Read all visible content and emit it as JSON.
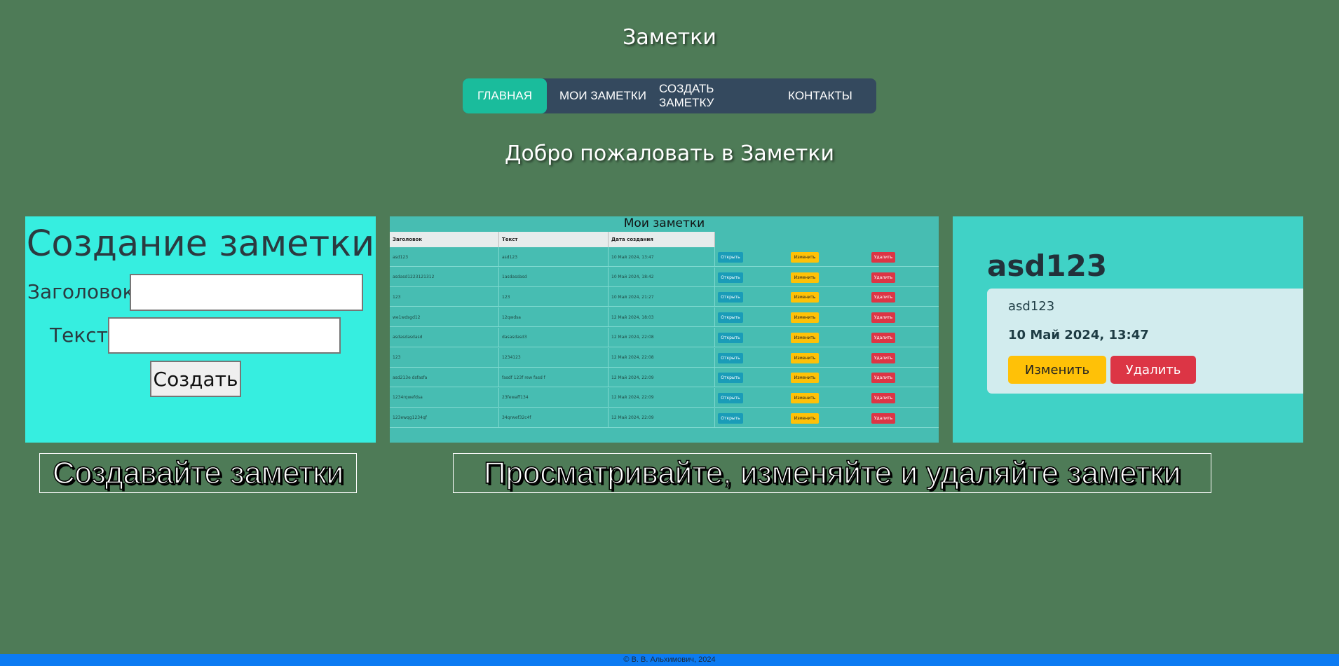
{
  "header": {
    "site_title": "Заметки"
  },
  "nav": {
    "items": [
      {
        "label": "ГЛАВНАЯ",
        "active": true
      },
      {
        "label": "МОИ ЗАМЕТКИ"
      },
      {
        "label": "СОЗДАТЬ ЗАМЕТКУ"
      },
      {
        "label": "КОНТАКТЫ"
      }
    ]
  },
  "main": {
    "welcome": "Добро пожаловать в Заметки"
  },
  "screenshots": {
    "create": {
      "title": "Создание заметки",
      "heading_label": "Заголовок:",
      "text_label": "Текст:",
      "create_button": "Создать"
    },
    "list": {
      "title": "Мои заметки",
      "columns": [
        "Заголовок",
        "Текст",
        "Дата создания"
      ],
      "open_label": "Открыть",
      "edit_label": "Изменить",
      "delete_label": "Удалить",
      "rows": [
        [
          "asd123",
          "asd123",
          "10 Май 2024, 13:47"
        ],
        [
          "asdasd1223121312",
          "1asdasdasd",
          "10 Май 2024, 18:42"
        ],
        [
          "123",
          "123",
          "10 Май 2024, 21:27"
        ],
        [
          "we1wdsgd12",
          "12qwdsa",
          "12 Май 2024, 18:03"
        ],
        [
          "asdasdasdasd",
          "dasasdasd3",
          "12 Май 2024, 22:08"
        ],
        [
          "123",
          "1234123",
          "12 Май 2024, 22:08"
        ],
        [
          "asd213e dsfasfa",
          "fasdf 123f rew fasd f",
          "12 Май 2024, 22:09"
        ],
        [
          "1234rqwefdsa",
          "23fewaff134",
          "12 Май 2024, 22:09"
        ],
        [
          "123ewqg1234qf",
          "34qrwef32c4f",
          "12 Май 2024, 22:09"
        ]
      ]
    },
    "view": {
      "title": "asd123",
      "text": "asd123",
      "date": "10 Май 2024, 13:47",
      "edit_button": "Изменить",
      "delete_button": "Удалить"
    }
  },
  "captions": {
    "create": "Создавайте заметки",
    "manage": "Просматривайте, изменяйте и удаляйте заметки"
  },
  "footer": {
    "text": "© В. В. Альхимович, 2024"
  },
  "colors": {
    "background": "#4e7b57",
    "nav": "#34495e",
    "nav_active": "#1abc9c",
    "footer": "#0d7bf2"
  }
}
